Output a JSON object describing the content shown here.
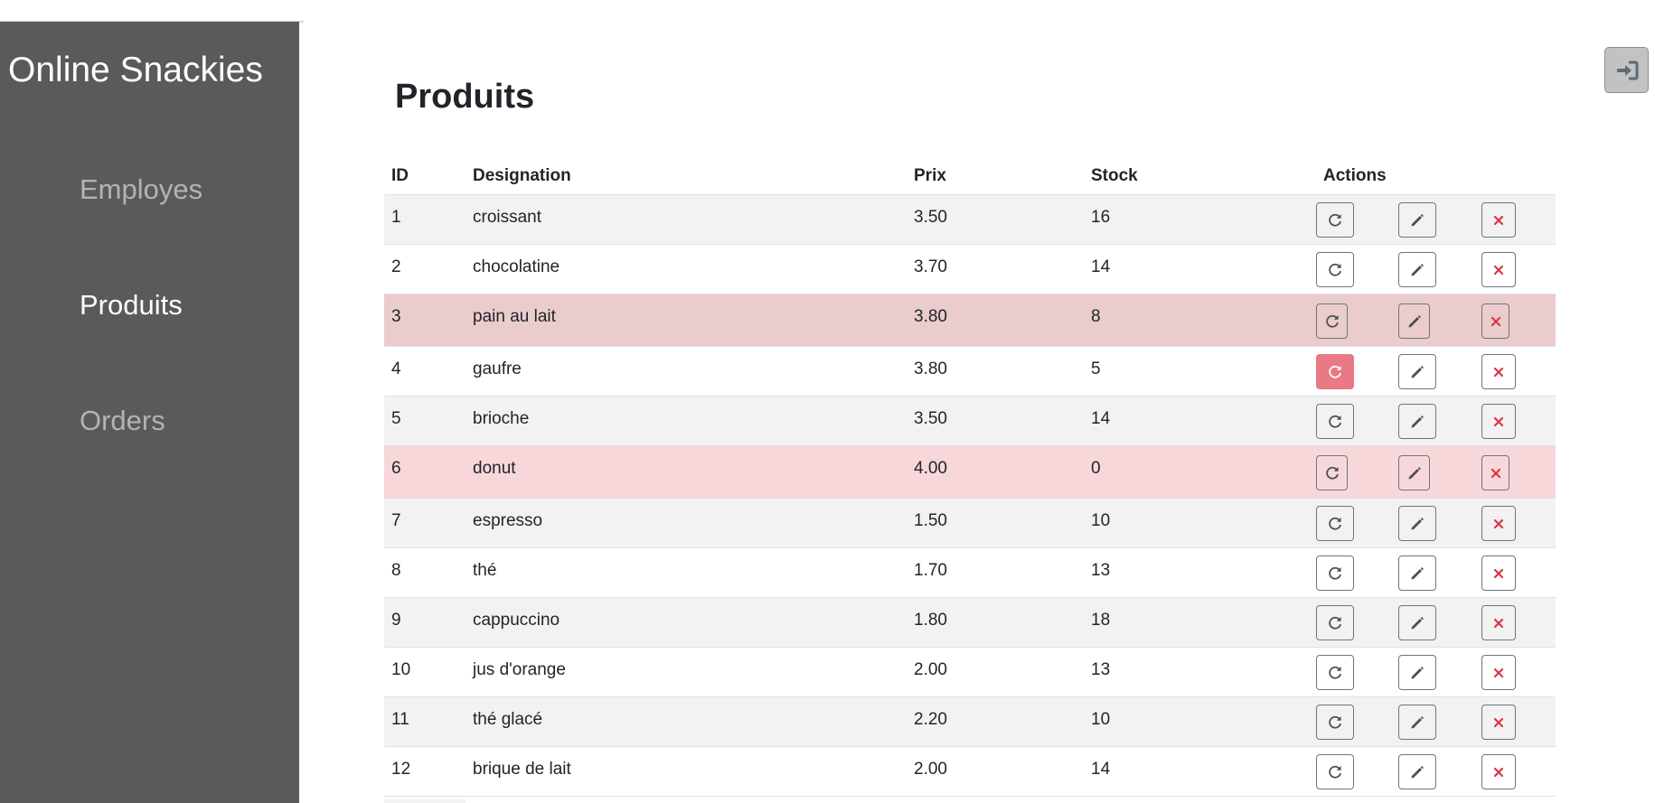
{
  "app": {
    "brand": "Online Snackies"
  },
  "sidebar": {
    "items": [
      {
        "label": "Employes",
        "active": false
      },
      {
        "label": "Produits",
        "active": true
      },
      {
        "label": "Orders",
        "active": false
      }
    ]
  },
  "header": {
    "logout_icon": "sign-in-icon"
  },
  "main": {
    "title": "Produits",
    "columns": {
      "id": "ID",
      "designation": "Designation",
      "prix": "Prix",
      "stock": "Stock",
      "actions": "Actions"
    },
    "rows": [
      {
        "id": "1",
        "designation": "croissant",
        "prix": "3.50",
        "stock": "16",
        "status": "normal"
      },
      {
        "id": "2",
        "designation": "chocolatine",
        "prix": "3.70",
        "stock": "14",
        "status": "normal"
      },
      {
        "id": "3",
        "designation": "pain au lait",
        "prix": "3.80",
        "stock": "8",
        "status": "warning"
      },
      {
        "id": "4",
        "designation": "gaufre",
        "prix": "3.80",
        "stock": "5",
        "status": "normal"
      },
      {
        "id": "5",
        "designation": "brioche",
        "prix": "3.50",
        "stock": "14",
        "status": "normal"
      },
      {
        "id": "6",
        "designation": "donut",
        "prix": "4.00",
        "stock": "0",
        "status": "danger"
      },
      {
        "id": "7",
        "designation": "espresso",
        "prix": "1.50",
        "stock": "10",
        "status": "normal"
      },
      {
        "id": "8",
        "designation": "thé",
        "prix": "1.70",
        "stock": "13",
        "status": "normal"
      },
      {
        "id": "9",
        "designation": "cappuccino",
        "prix": "1.80",
        "stock": "18",
        "status": "normal"
      },
      {
        "id": "10",
        "designation": "jus d'orange",
        "prix": "2.00",
        "stock": "13",
        "status": "normal"
      },
      {
        "id": "11",
        "designation": "thé glacé",
        "prix": "2.20",
        "stock": "10",
        "status": "normal"
      },
      {
        "id": "12",
        "designation": "brique de lait",
        "prix": "2.00",
        "stock": "14",
        "status": "normal"
      }
    ],
    "action_icons": [
      "refresh-icon",
      "pencil-icon",
      "close-icon"
    ]
  },
  "colors": {
    "sidebar_bg": "#5a5a5a",
    "row_striped": "#f2f2f2",
    "row_warning": "#ebcccd",
    "row_danger": "#f8d7db",
    "hot_button": "#e87985",
    "delete_icon": "#dc3545",
    "button_border": "#6c757d"
  }
}
